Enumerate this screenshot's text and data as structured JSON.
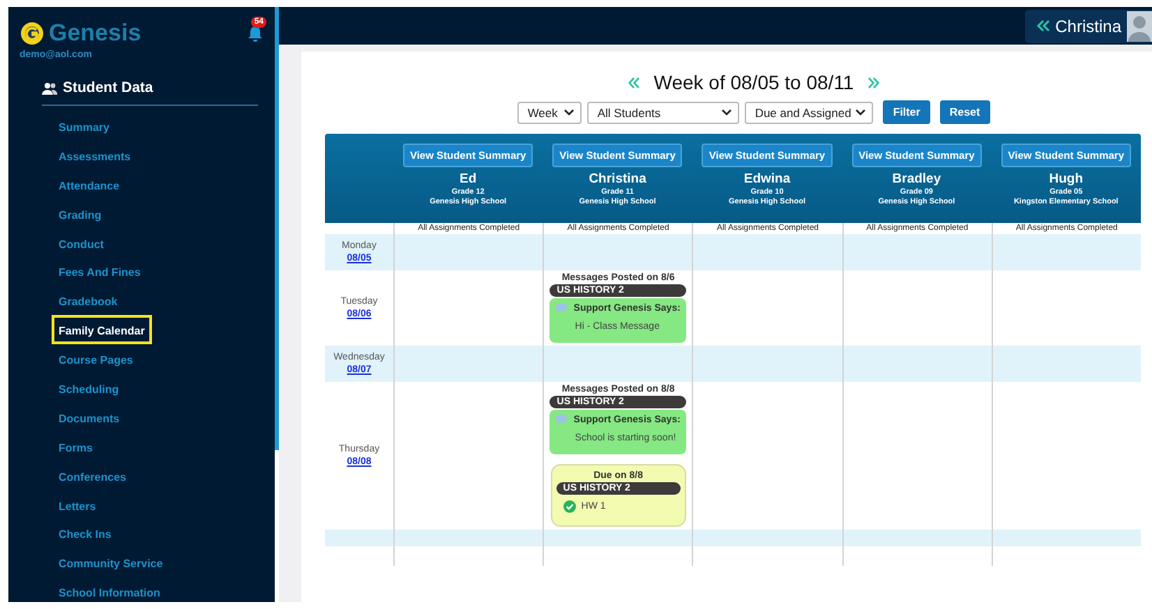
{
  "sidebar": {
    "logo": "Genesis",
    "notifications": "54",
    "email": "demo@aol.com",
    "section": "Student Data",
    "items": [
      {
        "label": "Summary",
        "selected": false
      },
      {
        "label": "Assessments",
        "selected": false
      },
      {
        "label": "Attendance",
        "selected": false
      },
      {
        "label": "Grading",
        "selected": false
      },
      {
        "label": "Conduct",
        "selected": false
      },
      {
        "label": "Fees And Fines",
        "selected": false
      },
      {
        "label": "Gradebook",
        "selected": false
      },
      {
        "label": "Family Calendar",
        "selected": true
      },
      {
        "label": "Course Pages",
        "selected": false
      },
      {
        "label": "Scheduling",
        "selected": false
      },
      {
        "label": "Documents",
        "selected": false
      },
      {
        "label": "Forms",
        "selected": false
      },
      {
        "label": "Conferences",
        "selected": false
      },
      {
        "label": "Letters",
        "selected": false
      },
      {
        "label": "Check Ins",
        "selected": false
      },
      {
        "label": "Community Service",
        "selected": false
      },
      {
        "label": "School Information",
        "selected": false
      }
    ]
  },
  "topbar": {
    "user": "Christina"
  },
  "calendar": {
    "title": "Week of 08/05 to 08/11",
    "filters": [
      {
        "value": "Week"
      },
      {
        "value": "All Students"
      },
      {
        "value": "Due and Assigned"
      }
    ],
    "buttons": [
      "Filter",
      "Reset"
    ],
    "students": [
      {
        "summary_button": "View Student Summary",
        "name": "Ed",
        "grade": "Grade 12",
        "school": "Genesis High School",
        "status": "All Assignments Completed"
      },
      {
        "summary_button": "View Student Summary",
        "name": "Christina",
        "grade": "Grade 11",
        "school": "Genesis High School",
        "status": "All Assignments Completed"
      },
      {
        "summary_button": "View Student Summary",
        "name": "Edwina",
        "grade": "Grade 10",
        "school": "Genesis High School",
        "status": "All Assignments Completed"
      },
      {
        "summary_button": "View Student Summary",
        "name": "Bradley",
        "grade": "Grade 09",
        "school": "Genesis High School",
        "status": "All Assignments Completed"
      },
      {
        "summary_button": "View Student Summary",
        "name": "Hugh",
        "grade": "Grade 05",
        "school": "Kingston Elementary School",
        "status": "All Assignments Completed"
      }
    ],
    "days": [
      {
        "day": "Monday",
        "date": "08/05",
        "cells": [
          {},
          {},
          {},
          {},
          {}
        ]
      },
      {
        "day": "Tuesday",
        "date": "08/06",
        "cells": [
          {},
          {
            "entries": [
              {
                "kind": "messages",
                "heading": "Messages Posted on 8/6",
                "course": "US HISTORY 2",
                "author": "Support Genesis Says:",
                "message": "Hi - Class Message"
              }
            ]
          },
          {},
          {},
          {}
        ]
      },
      {
        "day": "Wednesday",
        "date": "08/07",
        "cells": [
          {},
          {},
          {},
          {},
          {}
        ]
      },
      {
        "day": "Thursday",
        "date": "08/08",
        "cells": [
          {},
          {
            "entries": [
              {
                "kind": "messages",
                "heading": "Messages Posted on 8/8",
                "course": "US HISTORY 2",
                "author": "Support Genesis Says:",
                "message": "School is starting soon!"
              },
              {
                "kind": "due",
                "heading": "Due on 8/8",
                "course": "US HISTORY 2",
                "assignment": "HW 1",
                "completed": true
              }
            ]
          },
          {},
          {},
          {}
        ]
      }
    ]
  }
}
